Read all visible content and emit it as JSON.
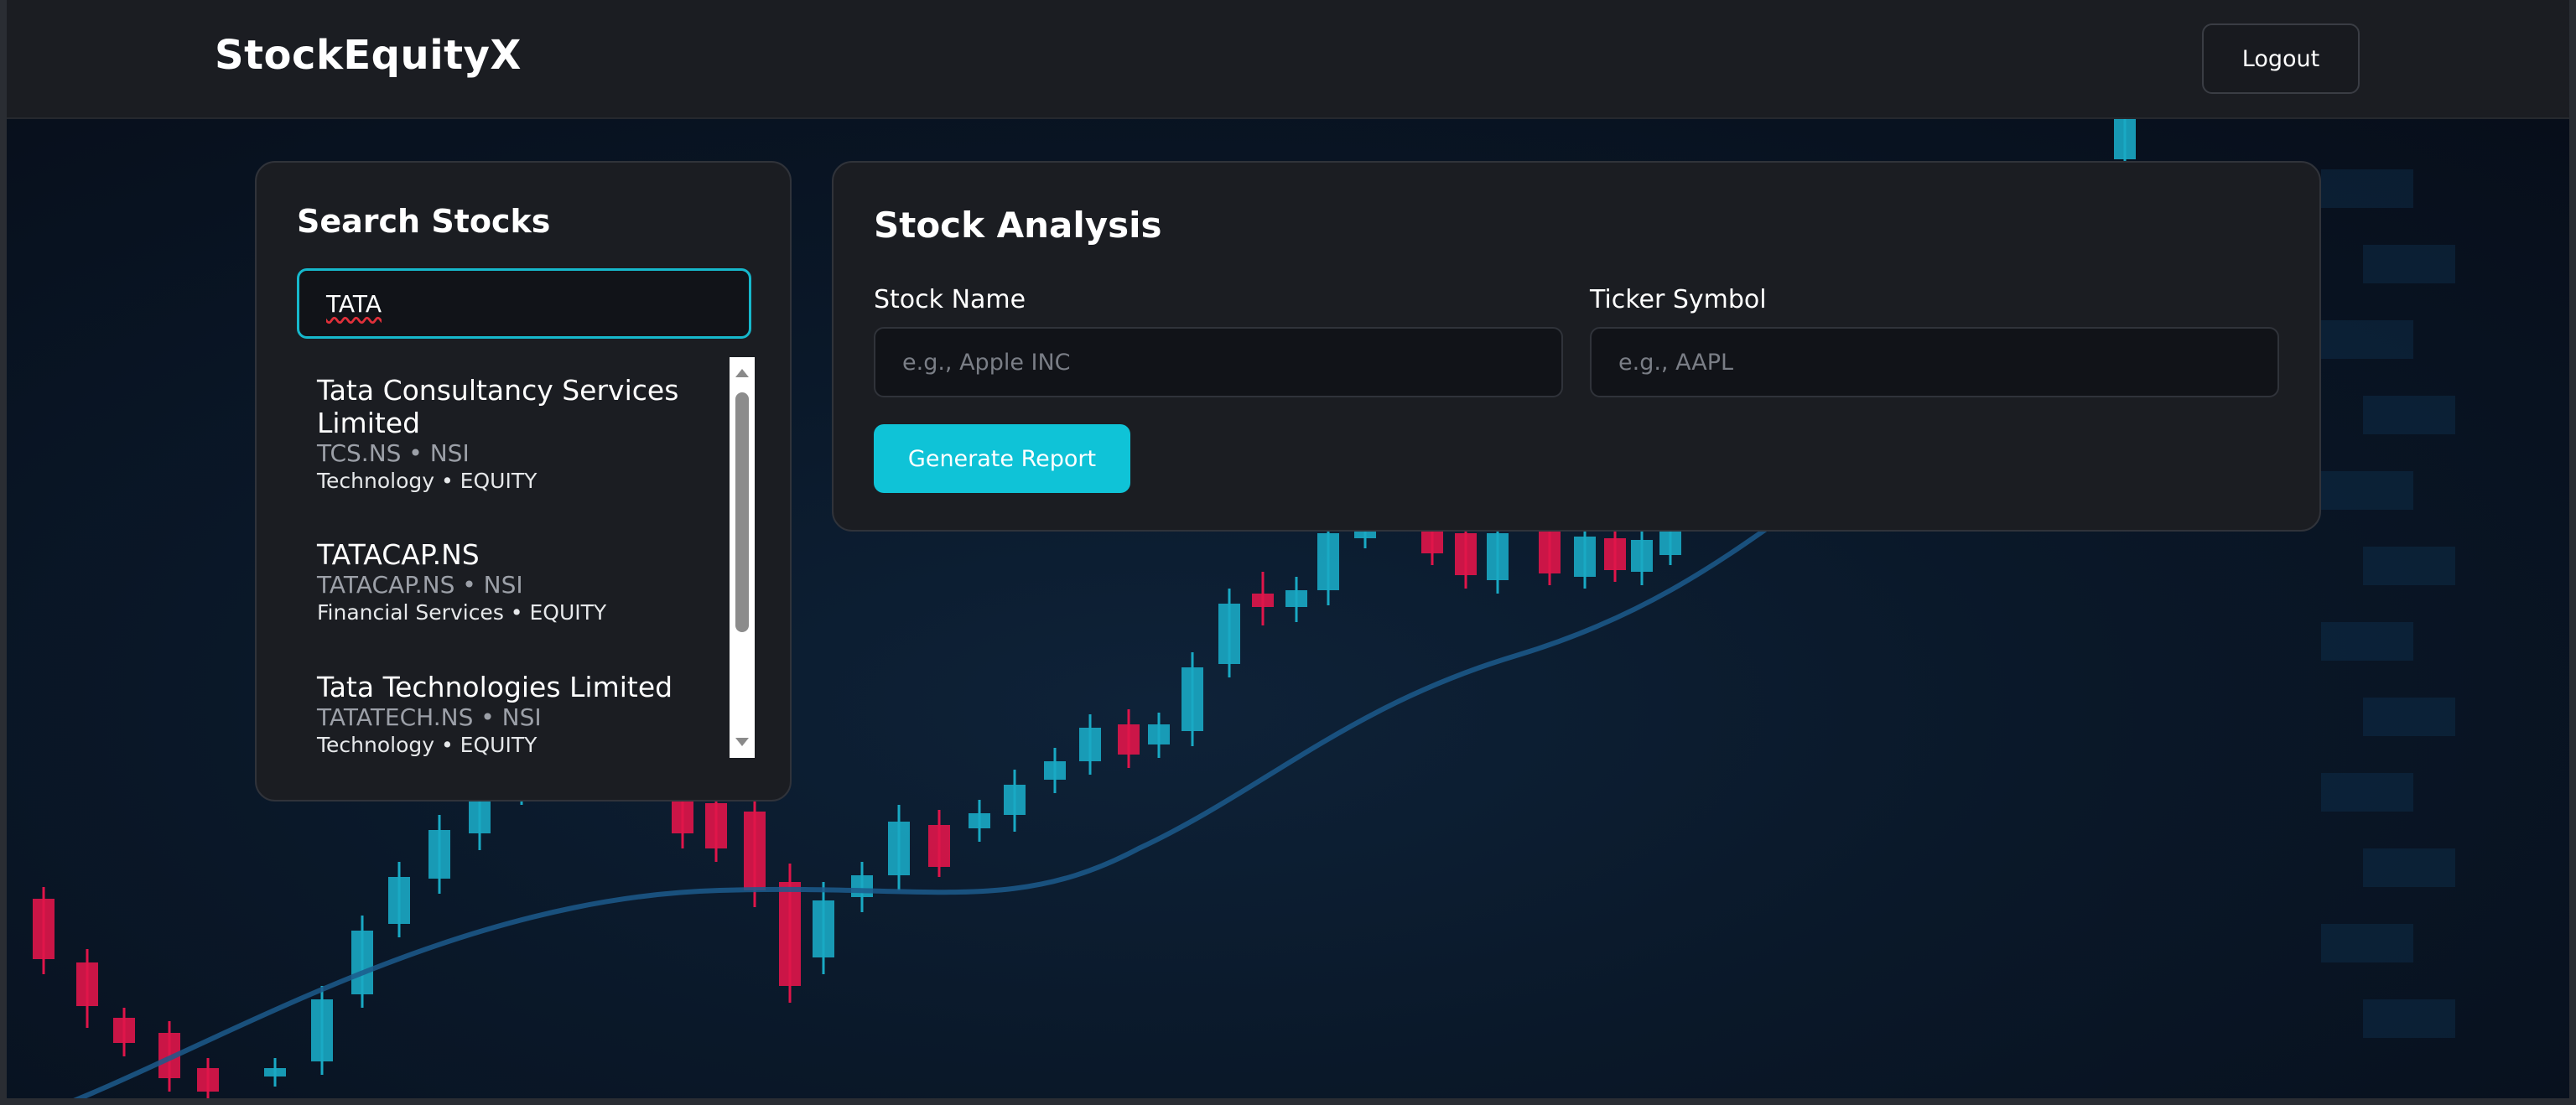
{
  "header": {
    "brand": "StockEquityX",
    "logout_label": "Logout"
  },
  "search": {
    "title": "Search Stocks",
    "query": "TATA",
    "results": [
      {
        "name": "Tata Consultancy Services Limited",
        "ticker_exchange": "TCS.NS • NSI",
        "sector_type": "Technology • EQUITY"
      },
      {
        "name": "TATACAP.NS",
        "ticker_exchange": "TATACAP.NS • NSI",
        "sector_type": "Financial Services • EQUITY"
      },
      {
        "name": "Tata Technologies Limited",
        "ticker_exchange": "TATATECH.NS • NSI",
        "sector_type": "Technology • EQUITY"
      }
    ]
  },
  "analysis": {
    "title": "Stock Analysis",
    "stock_name_label": "Stock Name",
    "stock_name_placeholder": "e.g., Apple INC",
    "ticker_label": "Ticker Symbol",
    "ticker_placeholder": "e.g., AAPL",
    "generate_label": "Generate Report"
  },
  "colors": {
    "accent": "#0fc3d7",
    "candle_up": "#19a9c4",
    "candle_down": "#e0154a",
    "background": "#0b0f17"
  }
}
